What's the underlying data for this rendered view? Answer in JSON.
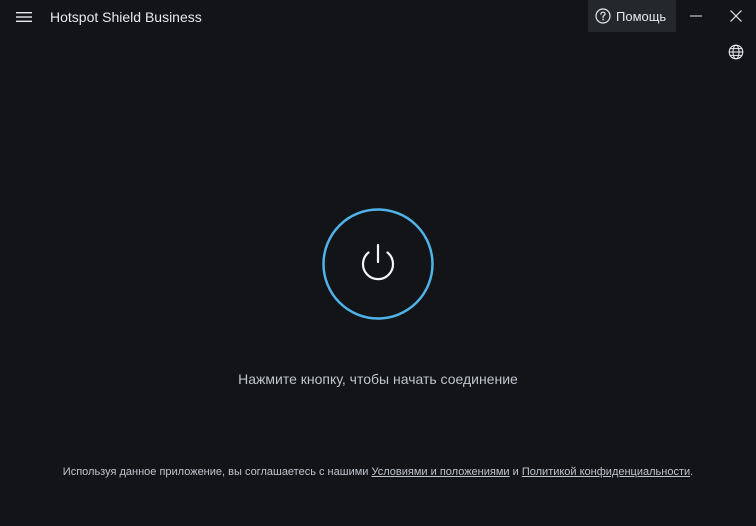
{
  "window": {
    "title": "Hotspot Shield Business",
    "help_label": "Помощь"
  },
  "icons": {
    "menu": "hamburger-menu-icon",
    "help": "question-circle-icon",
    "minimize": "minimize-icon",
    "close": "close-icon",
    "globe": "globe-icon",
    "power": "power-icon"
  },
  "main": {
    "status_text": "Нажмите кнопку, чтобы начать соединение"
  },
  "footer": {
    "prefix": "Используя данное приложение, вы соглашаетесь с нашими",
    "terms_link": "Условиями и положениями",
    "conjunction": "и",
    "privacy_link": "Политикой конфиденциальности",
    "suffix": "."
  },
  "colors": {
    "background": "#121417",
    "accent": "#4fb3e8",
    "text": "#e6e9ee",
    "muted_text": "#bfc5cd",
    "help_button_bg": "#24272c"
  }
}
